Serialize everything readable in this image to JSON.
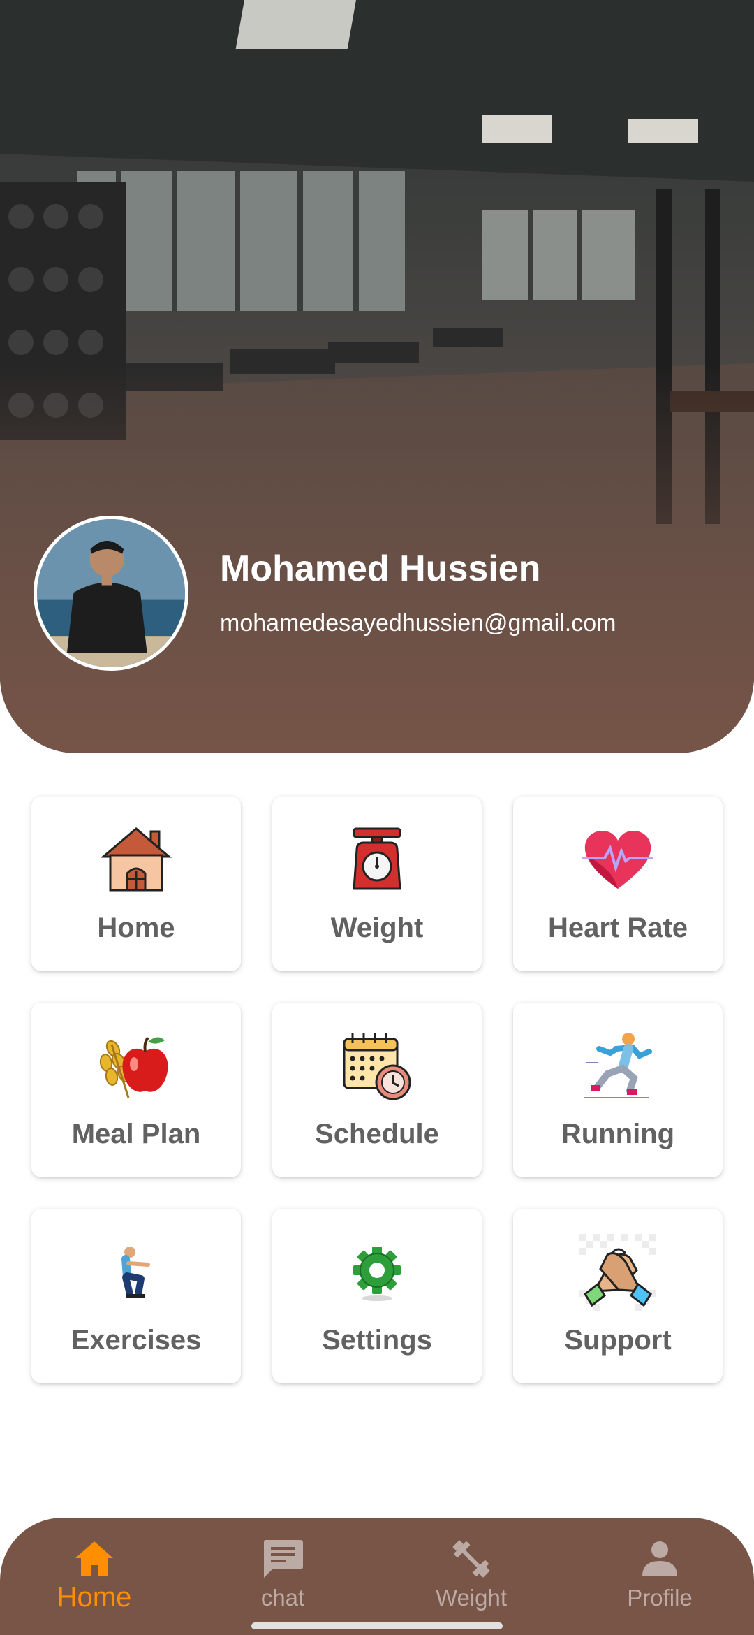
{
  "header": {
    "name": "Mohamed Hussien",
    "email": "mohamedesayedhussien@gmail.com"
  },
  "tiles": [
    {
      "label": "Home",
      "icon": "house-icon"
    },
    {
      "label": "Weight",
      "icon": "kitchen-scale-icon"
    },
    {
      "label": "Heart Rate",
      "icon": "heart-pulse-icon"
    },
    {
      "label": "Meal Plan",
      "icon": "apple-wheat-icon"
    },
    {
      "label": "Schedule",
      "icon": "calendar-clock-icon"
    },
    {
      "label": "Running",
      "icon": "runner-icon"
    },
    {
      "label": "Exercises",
      "icon": "squat-person-icon"
    },
    {
      "label": "Settings",
      "icon": "gear-icon"
    },
    {
      "label": "Support",
      "icon": "handshake-icon"
    }
  ],
  "bottom_nav": {
    "items": [
      {
        "label": "Home",
        "icon": "home-icon",
        "active": true
      },
      {
        "label": "chat",
        "icon": "chat-icon",
        "active": false
      },
      {
        "label": "Weight",
        "icon": "dumbbell-icon",
        "active": false
      },
      {
        "label": "Profile",
        "icon": "person-icon",
        "active": false
      }
    ],
    "active_color": "#ff8f00",
    "inactive_color": "#bcaaa4",
    "background": "#795548"
  }
}
